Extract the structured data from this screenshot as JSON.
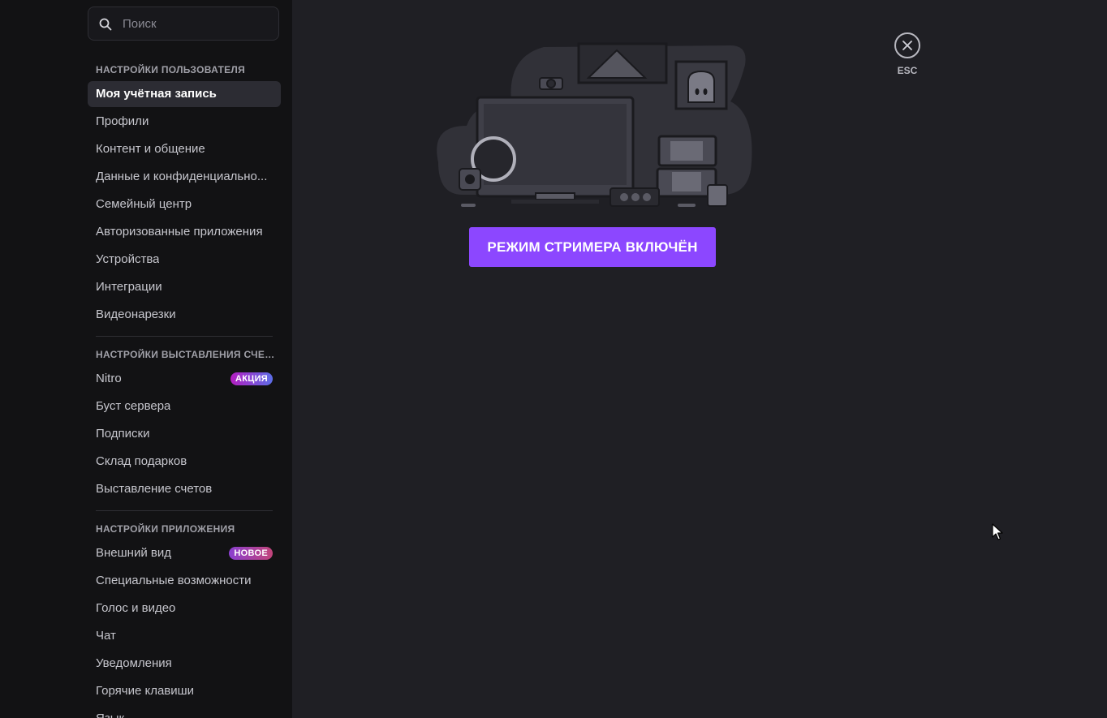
{
  "search": {
    "placeholder": "Поиск"
  },
  "sections": {
    "user": {
      "title": "НАСТРОЙКИ ПОЛЬЗОВАТЕЛЯ",
      "items": [
        "Моя учётная запись",
        "Профили",
        "Контент и общение",
        "Данные и конфиденциально...",
        "Семейный центр",
        "Авторизованные приложения",
        "Устройства",
        "Интеграции",
        "Видеонарезки"
      ]
    },
    "billing": {
      "title": "НАСТРОЙКИ ВЫСТАВЛЕНИЯ СЧЕТ...",
      "items": [
        "Nitro",
        "Буст сервера",
        "Подписки",
        "Склад подарков",
        "Выставление счетов"
      ],
      "nitro_badge": "АКЦИЯ"
    },
    "app": {
      "title": "НАСТРОЙКИ ПРИЛОЖЕНИЯ",
      "items": [
        "Внешний вид",
        "Специальные возможности",
        "Голос и видео",
        "Чат",
        "Уведомления",
        "Горячие клавиши",
        "Язык"
      ],
      "appearance_badge": "НОВОЕ"
    }
  },
  "main": {
    "streamer_button": "РЕЖИМ СТРИМЕРА ВКЛЮЧЁН",
    "close_label": "ESC"
  },
  "colors": {
    "accent": "#8c47ff",
    "sidebar_bg": "#121214",
    "content_bg": "#1f1f24"
  }
}
